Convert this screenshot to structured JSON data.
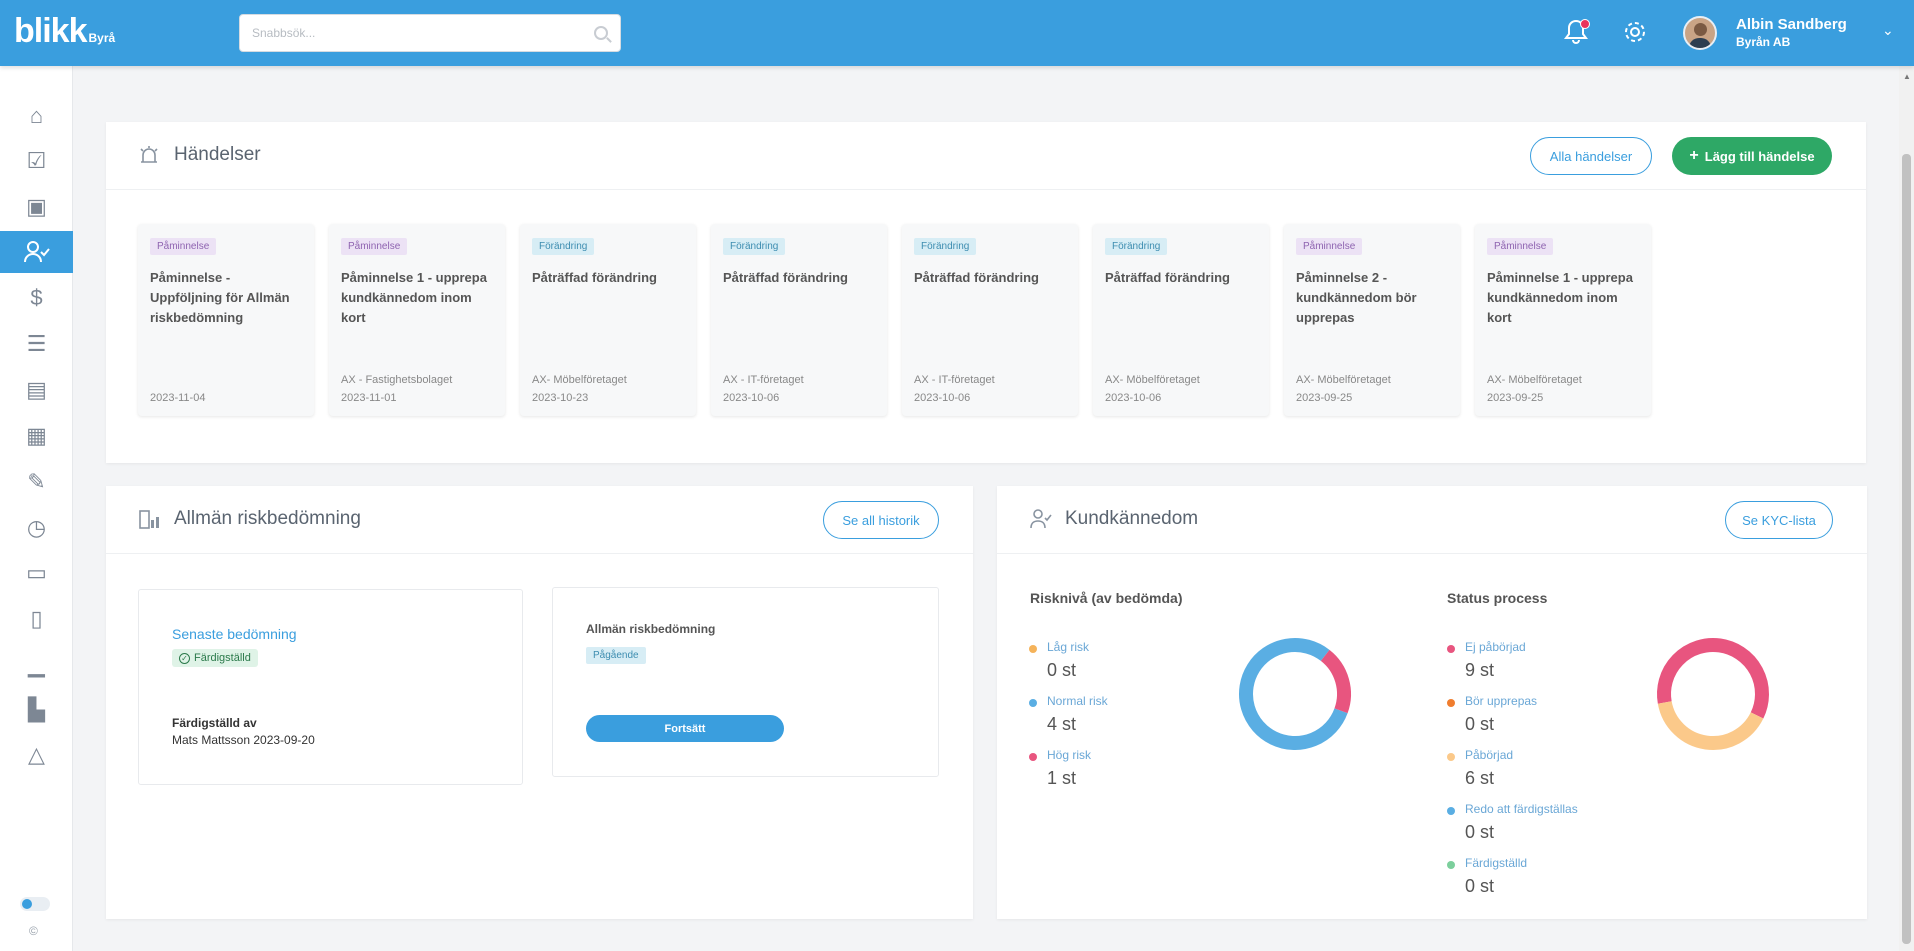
{
  "header": {
    "logo": "blikk",
    "logo_sub": "Byrå",
    "search_placeholder": "Snabbsök...",
    "user_name": "Albin Sandberg",
    "user_org": "Byrån AB"
  },
  "events": {
    "title": "Händelser",
    "all_button": "Alla händelser",
    "add_button": "Lägg till händelse",
    "items": [
      {
        "tag": "Påminnelse",
        "type": "rem",
        "title": "Påminnelse - Uppföljning för Allmän riskbedömning",
        "who": "",
        "date": "2023-11-04"
      },
      {
        "tag": "Påminnelse",
        "type": "rem",
        "title": "Påminnelse 1 - upprepa kundkännedom inom kort",
        "who": "AX - Fastighetsbolaget",
        "date": "2023-11-01"
      },
      {
        "tag": "Förändring",
        "type": "chg",
        "title": "Påträffad förändring",
        "who": "AX- Möbelföretaget",
        "date": "2023-10-23"
      },
      {
        "tag": "Förändring",
        "type": "chg",
        "title": "Påträffad förändring",
        "who": "AX - IT-företaget",
        "date": "2023-10-06"
      },
      {
        "tag": "Förändring",
        "type": "chg",
        "title": "Påträffad förändring",
        "who": "AX - IT-företaget",
        "date": "2023-10-06"
      },
      {
        "tag": "Förändring",
        "type": "chg",
        "title": "Påträffad förändring",
        "who": "AX- Möbelföretaget",
        "date": "2023-10-06"
      },
      {
        "tag": "Påminnelse",
        "type": "rem",
        "title": "Påminnelse 2 - kundkännedom bör upprepas",
        "who": "AX- Möbelföretaget",
        "date": "2023-09-25"
      },
      {
        "tag": "Påminnelse",
        "type": "rem",
        "title": "Påminnelse 1 - upprepa kundkännedom inom kort",
        "who": "AX- Möbelföretaget",
        "date": "2023-09-25"
      }
    ]
  },
  "risk": {
    "title": "Allmän riskbedömning",
    "history_button": "Se all historik",
    "latest_label": "Senaste bedömning",
    "latest_status": "Färdigställd",
    "completed_by_label": "Färdigställd av",
    "completed_by_value": "Mats Mattsson 2023-09-20",
    "current_title": "Allmän riskbedömning",
    "current_status": "Pågående",
    "continue_button": "Fortsätt"
  },
  "kyc": {
    "title": "Kundkännedom",
    "list_button": "Se KYC-lista",
    "risk_section": "Risknivå (av bedömda)",
    "risk_items": [
      {
        "label": "Låg risk",
        "value": "0 st",
        "count": 0,
        "color": "#f5b35a"
      },
      {
        "label": "Normal risk",
        "value": "4 st",
        "count": 4,
        "color": "#5aaee3"
      },
      {
        "label": "Hög risk",
        "value": "1 st",
        "count": 1,
        "color": "#e8557f"
      }
    ],
    "status_section": "Status process",
    "status_items": [
      {
        "label": "Ej påbörjad",
        "value": "9 st",
        "count": 9,
        "color": "#e8557f"
      },
      {
        "label": "Bör upprepas",
        "value": "0 st",
        "count": 0,
        "color": "#f07d2e"
      },
      {
        "label": "Påbörjad",
        "value": "6 st",
        "count": 6,
        "color": "#fbc98a"
      },
      {
        "label": "Redo att färdigställas",
        "value": "0 st",
        "count": 0,
        "color": "#5aaee3"
      },
      {
        "label": "Färdigställd",
        "value": "0 st",
        "count": 0,
        "color": "#7ccf9c"
      }
    ]
  },
  "footer": {
    "copyright": "©"
  }
}
